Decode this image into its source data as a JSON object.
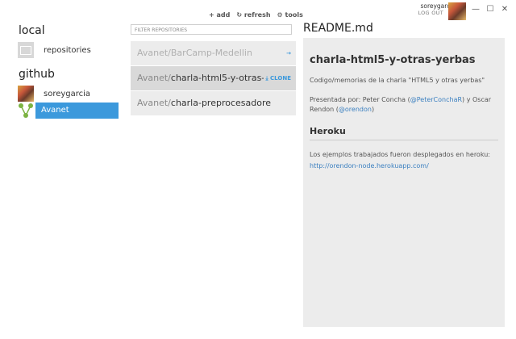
{
  "account": {
    "username": "soreygarcia",
    "logout": "LOG OUT"
  },
  "window_controls": {
    "minimize": "—",
    "maximize": "☐",
    "close": "✕"
  },
  "toolbar": {
    "add": "add",
    "refresh": "refresh",
    "tools": "tools",
    "add_icon": "+",
    "refresh_icon": "↻",
    "tools_icon": "⚙"
  },
  "sidebar": {
    "local_title": "local",
    "local_items": [
      {
        "label": "repositories",
        "icon": "monitor-icon"
      }
    ],
    "github_title": "github",
    "github_items": [
      {
        "label": "soreygarcia",
        "icon": "avatar"
      },
      {
        "label": "Avanet",
        "icon": "org-icon",
        "selected": true
      }
    ]
  },
  "filter": {
    "placeholder": "FILTER REPOSITORIES"
  },
  "repos": [
    {
      "org": "Avanet/",
      "name": "BarCamp-Medellin",
      "action": "→",
      "faded": true
    },
    {
      "org": "Avanet/",
      "name": "charla-html5-y-otras-y",
      "action": "⤓ CLONE",
      "selected": true
    },
    {
      "org": "Avanet/",
      "name": "charla-preprocesadore",
      "action": ""
    }
  ],
  "readme": {
    "filename": "README.md",
    "heading": "charla-html5-y-otras-yerbas",
    "description": "Codigo/memorias de la charla \"HTML5 y otras yerbas\"",
    "presented_prefix": "Presentada por: Peter Concha (",
    "presenter1_handle": "@PeterConchaR",
    "presented_mid": ") y Oscar Rendon (",
    "presenter2_handle": "@orendon",
    "presented_suffix": ")",
    "section_heading": "Heroku",
    "section_text": "Los ejemplos trabajados fueron desplegados en heroku:",
    "section_link": "http://orendon-node.herokuapp.com/"
  },
  "colors": {
    "accent": "#3c99dc",
    "panel": "#ececec",
    "selected_row": "#d9d9d9"
  }
}
